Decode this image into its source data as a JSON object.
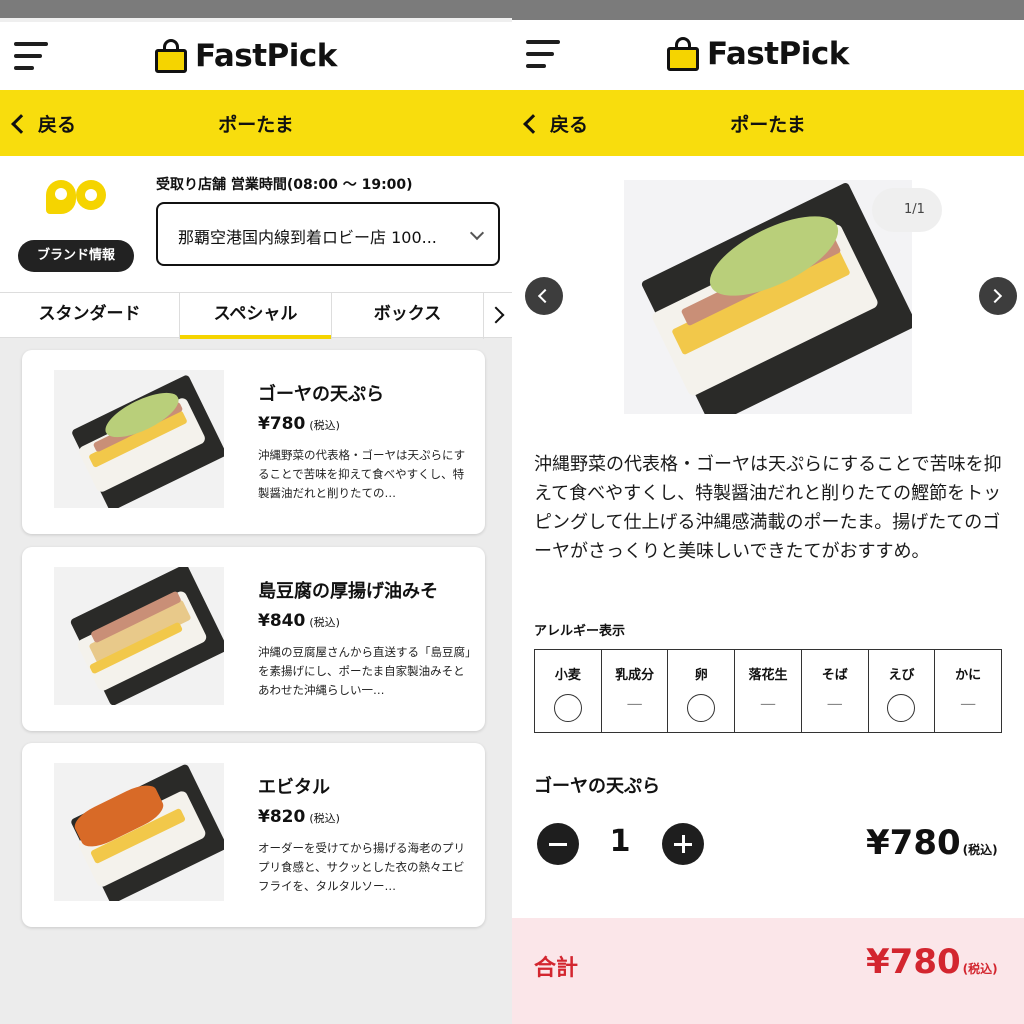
{
  "app": {
    "brand": "FastPick",
    "brand_color": "#f8dd0d",
    "accent_red": "#d3262f"
  },
  "list_screen": {
    "header": {
      "back_label": "戻る",
      "title": "ポーたま"
    },
    "store": {
      "brand_info_label": "ブランド情報",
      "label": "受取り店舗 営業時間(08:00 〜 19:00)",
      "selected_store": "那覇空港国内線到着ロビー店 100..."
    },
    "tabs": [
      {
        "label": "スタンダード",
        "active": false
      },
      {
        "label": "スペシャル",
        "active": true
      },
      {
        "label": "ボックス",
        "active": false
      }
    ],
    "products": [
      {
        "name": "ゴーヤの天ぷら",
        "price": "¥780",
        "tax": "(税込)",
        "desc": "沖縄野菜の代表格・ゴーヤは天ぷらにすることで苦味を抑えて食べやすくし、特製醤油だれと削りたての…"
      },
      {
        "name": "島豆腐の厚揚げ油みそ",
        "price": "¥840",
        "tax": "(税込)",
        "desc": "沖縄の豆腐屋さんから直送する「島豆腐」を素揚げにし、ポーたま自家製油みそとあわせた沖縄らしい一…"
      },
      {
        "name": "エビタル",
        "price": "¥820",
        "tax": "(税込)",
        "desc": "オーダーを受けてから揚げる海老のプリプリ食感と、サクッとした衣の熱々エビフライを、タルタルソー…"
      }
    ]
  },
  "detail_screen": {
    "header": {
      "back_label": "戻る",
      "title": "ポーたま"
    },
    "photo_counter": "1/1",
    "description": "沖縄野菜の代表格・ゴーヤは天ぷらにすることで苦味を抑えて食べやすくし、特製醤油だれと削りたての鰹節をトッピングして仕上げる沖縄感満載のポーたま。揚げたてのゴーヤがさっくりと美味しいできたてがおすすめ。",
    "allergy_title": "アレルギー表示",
    "allergens": [
      {
        "label": "小麦",
        "contains": true
      },
      {
        "label": "乳成分",
        "contains": false,
        "mark": "—"
      },
      {
        "label": "卵",
        "contains": true
      },
      {
        "label": "落花生",
        "contains": false,
        "mark": "—"
      },
      {
        "label": "そば",
        "contains": false,
        "mark": "—"
      },
      {
        "label": "えび",
        "contains": true
      },
      {
        "label": "かに",
        "contains": false,
        "mark": "—"
      }
    ],
    "item_name": "ゴーヤの天ぷら",
    "quantity": "1",
    "item_price": "¥780",
    "tax": "(税込)",
    "total_label": "合計",
    "total_price": "¥780"
  }
}
